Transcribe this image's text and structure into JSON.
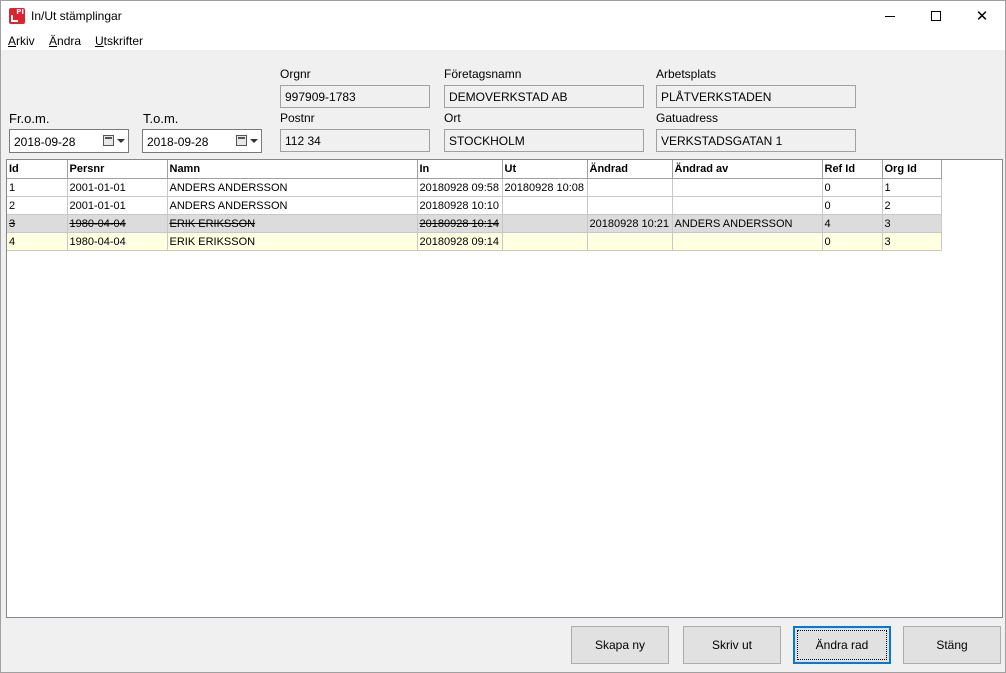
{
  "window": {
    "title": "In/Ut stämplingar"
  },
  "menu": {
    "items": [
      {
        "label": "Arkiv",
        "mnemonic": "A",
        "rest": "rkiv"
      },
      {
        "label": "Ändra",
        "mnemonic": "Ä",
        "rest": "ndra"
      },
      {
        "label": "Utskrifter",
        "mnemonic": "U",
        "rest": "tskrifter"
      }
    ]
  },
  "filters": {
    "from_label": "Fr.o.m.",
    "from_value": "2018-09-28",
    "to_label": "T.o.m.",
    "to_value": "2018-09-28"
  },
  "company": {
    "orgnr_label": "Orgnr",
    "orgnr_value": "997909-1783",
    "name_label": "Företagsnamn",
    "name_value": "DEMOVERKSTAD AB",
    "workplace_label": "Arbetsplats",
    "workplace_value": "PLÅTVERKSTADEN",
    "postnr_label": "Postnr",
    "postnr_value": "112 34",
    "city_label": "Ort",
    "city_value": "STOCKHOLM",
    "street_label": "Gatuadress",
    "street_value": "VERKSTADSGATAN 1"
  },
  "table": {
    "columns": [
      "Id",
      "Persnr",
      "Namn",
      "In",
      "Ut",
      "Ändrad",
      "Ändrad av",
      "Ref Id",
      "Org Id"
    ],
    "rows": [
      {
        "id": "1",
        "persnr": "2001-01-01",
        "namn": "ANDERS ANDERSSON",
        "in": "20180928 09:58",
        "ut": "20180928 10:08",
        "andrad": "",
        "andrad_av": "",
        "ref_id": "0",
        "org_id": "1",
        "state": "normal"
      },
      {
        "id": "2",
        "persnr": "2001-01-01",
        "namn": "ANDERS ANDERSSON",
        "in": "20180928 10:10",
        "ut": "",
        "andrad": "",
        "andrad_av": "",
        "ref_id": "0",
        "org_id": "2",
        "state": "normal"
      },
      {
        "id": "3",
        "persnr": "1980-04-04",
        "namn": "ERIK ERIKSSON",
        "in": "20180928 10:14",
        "ut": "",
        "andrad": "20180928 10:21",
        "andrad_av": "ANDERS ANDERSSON",
        "ref_id": "4",
        "org_id": "3",
        "state": "deleted"
      },
      {
        "id": "4",
        "persnr": "1980-04-04",
        "namn": "ERIK ERIKSSON",
        "in": "20180928 09:14",
        "ut": "",
        "andrad": "",
        "andrad_av": "",
        "ref_id": "0",
        "org_id": "3",
        "state": "selected"
      }
    ]
  },
  "buttons": {
    "create": "Skapa ny",
    "print": "Skriv ut",
    "edit_row": "Ändra rad",
    "close": "Stäng"
  },
  "icons": {
    "app": "app-logo-icon",
    "calendar": "calendar-icon",
    "dropdown": "chevron-down-icon"
  },
  "colors": {
    "selected_row": "#ffffe1",
    "deleted_row": "#dcdcdc",
    "default_button_border": "#0078d7",
    "app_icon": "#d9262e"
  }
}
